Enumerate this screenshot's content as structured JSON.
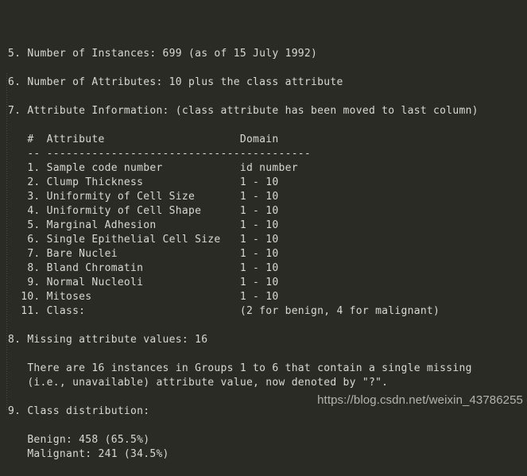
{
  "viewer": {
    "background_color": "#2b2b26",
    "text_color": "#d9d9d1",
    "indent_guide_color": "#4a4a41"
  },
  "document": {
    "lines": [
      "5. Number of Instances: 699 (as of 15 July 1992)",
      "",
      "6. Number of Attributes: 10 plus the class attribute",
      "",
      "7. Attribute Information: (class attribute has been moved to last column)",
      "",
      "   #  Attribute                     Domain",
      "   -- -----------------------------------------",
      "   1. Sample code number            id number",
      "   2. Clump Thickness               1 - 10",
      "   3. Uniformity of Cell Size       1 - 10",
      "   4. Uniformity of Cell Shape      1 - 10",
      "   5. Marginal Adhesion             1 - 10",
      "   6. Single Epithelial Cell Size   1 - 10",
      "   7. Bare Nuclei                   1 - 10",
      "   8. Bland Chromatin               1 - 10",
      "   9. Normal Nucleoli               1 - 10",
      "  10. Mitoses                       1 - 10",
      "  11. Class:                        (2 for benign, 4 for malignant)",
      "",
      "8. Missing attribute values: 16",
      "",
      "   There are 16 instances in Groups 1 to 6 that contain a single missing",
      "   (i.e., unavailable) attribute value, now denoted by \"?\".",
      "",
      "9. Class distribution:",
      "",
      "   Benign: 458 (65.5%)",
      "   Malignant: 241 (34.5%)"
    ],
    "sections": {
      "instances": {
        "number": "5.",
        "label": "Number of Instances:",
        "value": "699",
        "note": "(as of 15 July 1992)"
      },
      "attributes_count": {
        "number": "6.",
        "label": "Number of Attributes:",
        "value": "10 plus the class attribute"
      },
      "attribute_information": {
        "number": "7.",
        "label": "Attribute Information:",
        "note": "(class attribute has been moved to last column)",
        "table": {
          "headers": [
            "#",
            "Attribute",
            "Domain"
          ],
          "separator": "-- -----------------------------------------",
          "rows": [
            {
              "index": "1.",
              "attribute": "Sample code number",
              "domain": "id number"
            },
            {
              "index": "2.",
              "attribute": "Clump Thickness",
              "domain": "1 - 10"
            },
            {
              "index": "3.",
              "attribute": "Uniformity of Cell Size",
              "domain": "1 - 10"
            },
            {
              "index": "4.",
              "attribute": "Uniformity of Cell Shape",
              "domain": "1 - 10"
            },
            {
              "index": "5.",
              "attribute": "Marginal Adhesion",
              "domain": "1 - 10"
            },
            {
              "index": "6.",
              "attribute": "Single Epithelial Cell Size",
              "domain": "1 - 10"
            },
            {
              "index": "7.",
              "attribute": "Bare Nuclei",
              "domain": "1 - 10"
            },
            {
              "index": "8.",
              "attribute": "Bland Chromatin",
              "domain": "1 - 10"
            },
            {
              "index": "9.",
              "attribute": "Normal Nucleoli",
              "domain": "1 - 10"
            },
            {
              "index": "10.",
              "attribute": "Mitoses",
              "domain": "1 - 10"
            },
            {
              "index": "11.",
              "attribute": "Class:",
              "domain": "(2 for benign, 4 for malignant)"
            }
          ]
        }
      },
      "missing_values": {
        "number": "8.",
        "label": "Missing attribute values:",
        "value": "16",
        "body_line_1": "There are 16 instances in Groups 1 to 6 that contain a single missing",
        "body_line_2": "(i.e., unavailable) attribute value, now denoted by \"?\"."
      },
      "class_distribution": {
        "number": "9.",
        "label": "Class distribution:",
        "benign": "Benign: 458 (65.5%)",
        "malignant": "Malignant: 241 (34.5%)"
      }
    }
  },
  "watermark": {
    "text": "https://blog.csdn.net/weixin_43786255"
  }
}
